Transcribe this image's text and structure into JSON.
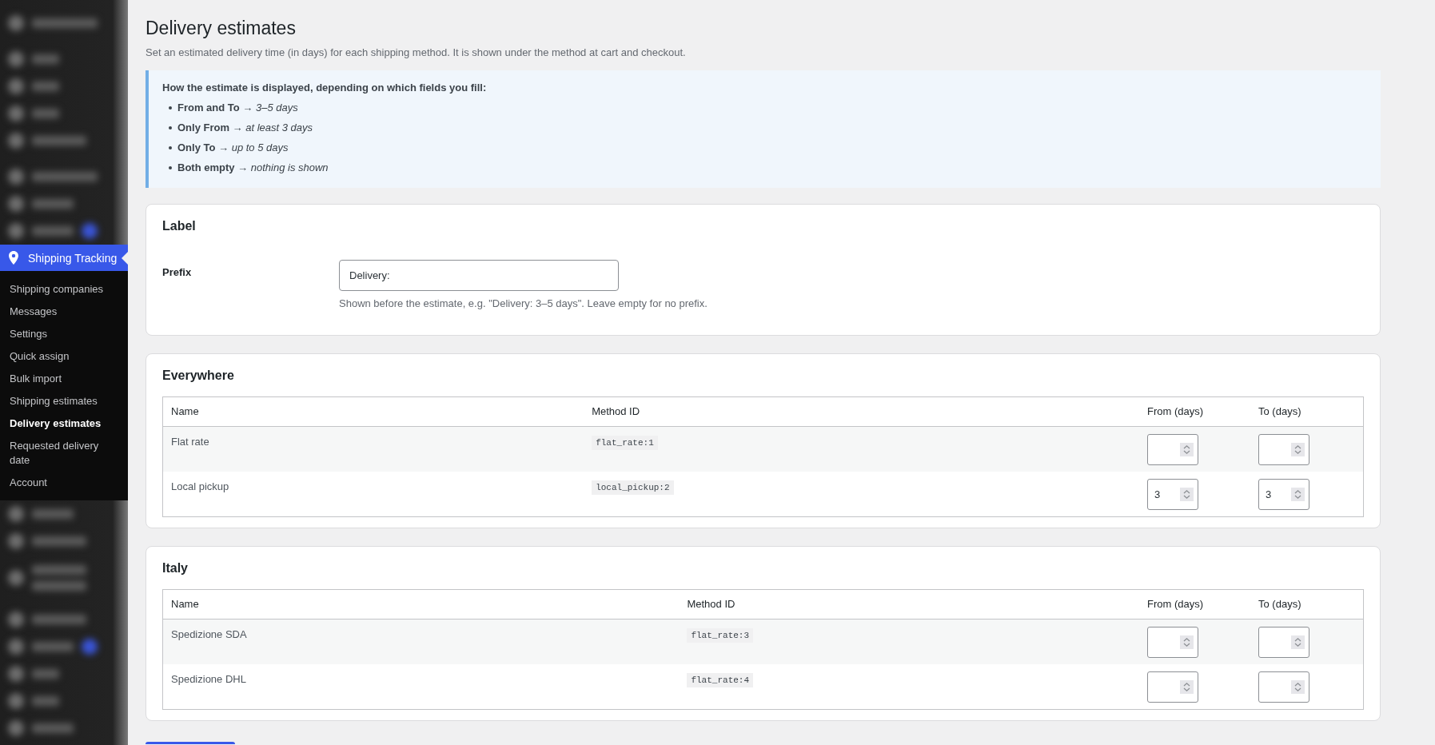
{
  "sidebar": {
    "active_menu": {
      "label": "Shipping Tracking",
      "current": true
    },
    "submenu": [
      {
        "label": "Shipping companies",
        "selected": false
      },
      {
        "label": "Messages",
        "selected": false
      },
      {
        "label": "Settings",
        "selected": false
      },
      {
        "label": "Quick assign",
        "selected": false
      },
      {
        "label": "Bulk import",
        "selected": false
      },
      {
        "label": "Shipping estimates",
        "selected": false
      },
      {
        "label": "Delivery estimates",
        "selected": true
      },
      {
        "label": "Requested delivery date",
        "selected": false
      },
      {
        "label": "Account",
        "selected": false
      }
    ]
  },
  "page": {
    "title": "Delivery estimates",
    "description": "Set an estimated delivery time (in days) for each shipping method. It is shown under the method at cart and checkout."
  },
  "notice": {
    "heading": "How the estimate is displayed, depending on which fields you fill:",
    "items": [
      "**From and To →** *3–5 days*",
      "**Only From →** *at least 3 days*",
      "**Only To →** *up to 5 days*",
      "**Both empty →** *nothing is shown*"
    ]
  },
  "label_section": {
    "title": "Label",
    "field": {
      "label": "Prefix",
      "value": "Delivery:",
      "help": "Shown before the estimate, e.g. \"Delivery: 3–5 days\". Leave empty for no prefix."
    }
  },
  "zones": [
    {
      "title": "Everywhere",
      "columns": [
        "Name",
        "Method ID",
        "From (days)",
        "To (days)"
      ],
      "rows": [
        {
          "name": "Flat rate",
          "method_id": "flat_rate:1"
        },
        {
          "name": "Local pickup",
          "method_id": "local_pickup:2",
          "from": "3",
          "to": "3"
        }
      ]
    },
    {
      "title": "Italy",
      "columns": [
        "Name",
        "Method ID",
        "From (days)",
        "To (days)"
      ],
      "rows": [
        {
          "name": "Spedizione SDA",
          "method_id": "flat_rate:3"
        },
        {
          "name": "Spedizione DHL",
          "method_id": "flat_rate:4"
        }
      ]
    }
  ]
}
